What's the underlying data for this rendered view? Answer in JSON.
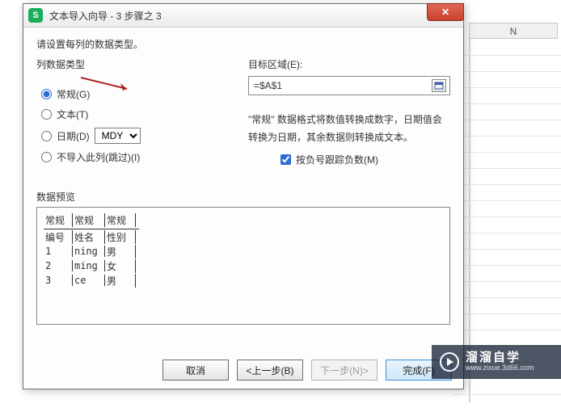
{
  "sheet": {
    "col_N": "N"
  },
  "dialog": {
    "title": "文本导入向导 - 3 步骤之 3",
    "instruction": "请设置每列的数据类型。",
    "col_type_label": "列数据类型",
    "radios": {
      "general": "常规(G)",
      "text": "文本(T)",
      "date": "日期(D)",
      "skip": "不导入此列(跳过)(I)"
    },
    "date_format": "MDY",
    "target_label": "目标区域(E):",
    "target_value": "=$A$1",
    "description": "\"常规\" 数据格式将数值转换成数字，日期值会转换为日期，其余数据则转换成文本。",
    "track_negative": "按负号跟踪负数(M)",
    "preview_label": "数据预览",
    "preview": {
      "col_types": [
        "常规",
        "常规",
        "常规"
      ],
      "headers": [
        "编号",
        "姓名",
        "性别"
      ],
      "rows": [
        [
          "1",
          "ning",
          "男"
        ],
        [
          "2",
          "ming",
          "女"
        ],
        [
          "3",
          "ce",
          "男"
        ]
      ]
    },
    "buttons": {
      "cancel": "取消",
      "back": "<上一步(B)",
      "next": "下一步(N)>",
      "finish": "完成(F)"
    }
  },
  "watermark": {
    "brand": "溜溜自学",
    "url": "www.zixue.3d66.com"
  }
}
